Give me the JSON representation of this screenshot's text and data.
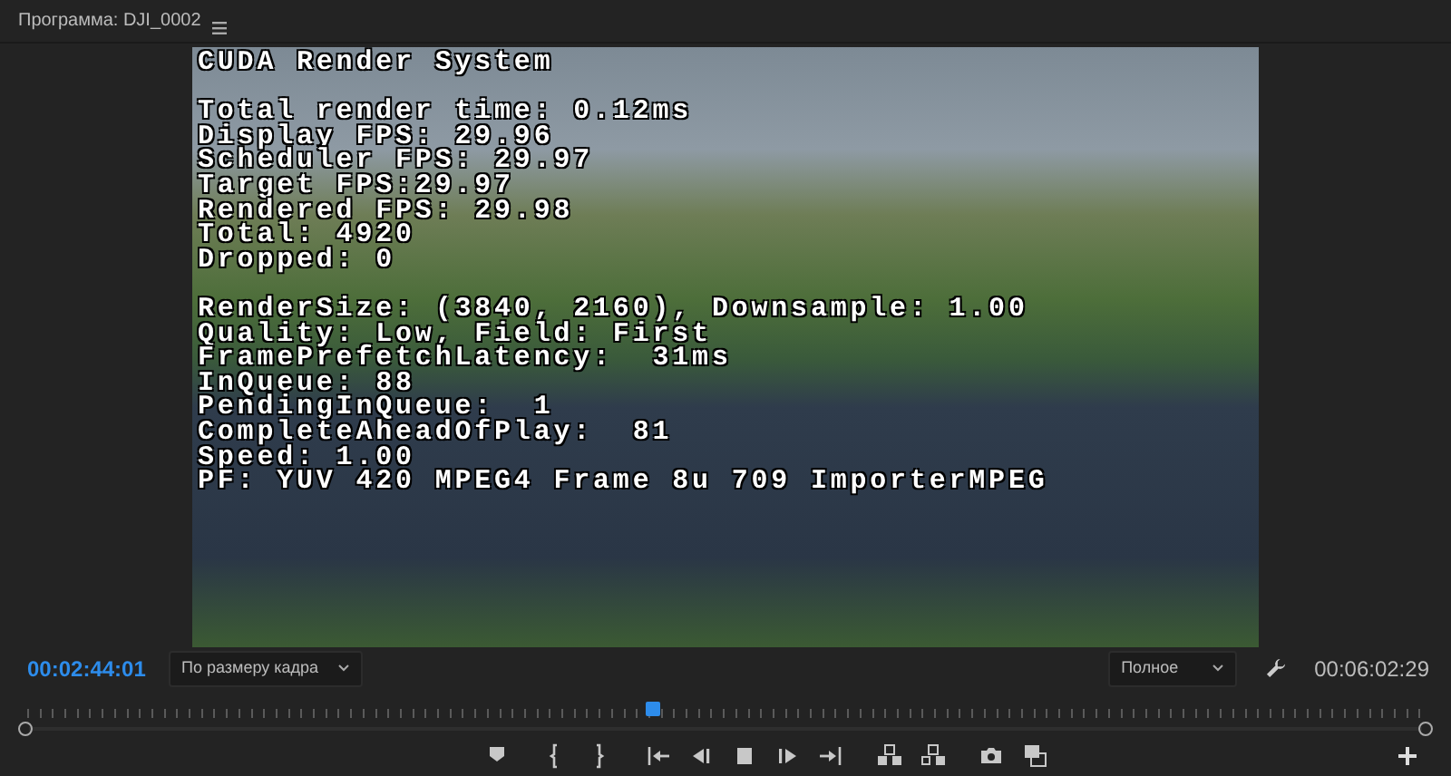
{
  "panel": {
    "title": "Программа: DJI_0002"
  },
  "overlay": {
    "sections": [
      [
        "CUDA Render System"
      ],
      [
        "Total render time: 0.12ms",
        "Display FPS: 29.96",
        "Scheduler FPS: 29.97",
        "Target FPS:29.97",
        "Rendered FPS: 29.98",
        "Total: 4920",
        "Dropped: 0"
      ],
      [
        "RenderSize: (3840, 2160), Downsample: 1.00",
        "Quality: Low, Field: First",
        "FramePrefetchLatency:  31ms",
        "InQueue: 88",
        "PendingInQueue:  1",
        "CompleteAheadOfPlay:  81",
        "Speed: 1.00",
        "PF: YUV 420 MPEG4 Frame 8u 709 ImporterMPEG"
      ]
    ]
  },
  "current_time": "00:02:44:01",
  "zoom_select": {
    "value": "По размеру кадра"
  },
  "quality_select": {
    "value": "Полное"
  },
  "duration": "00:06:02:29",
  "timeline": {
    "level": 0.448
  }
}
